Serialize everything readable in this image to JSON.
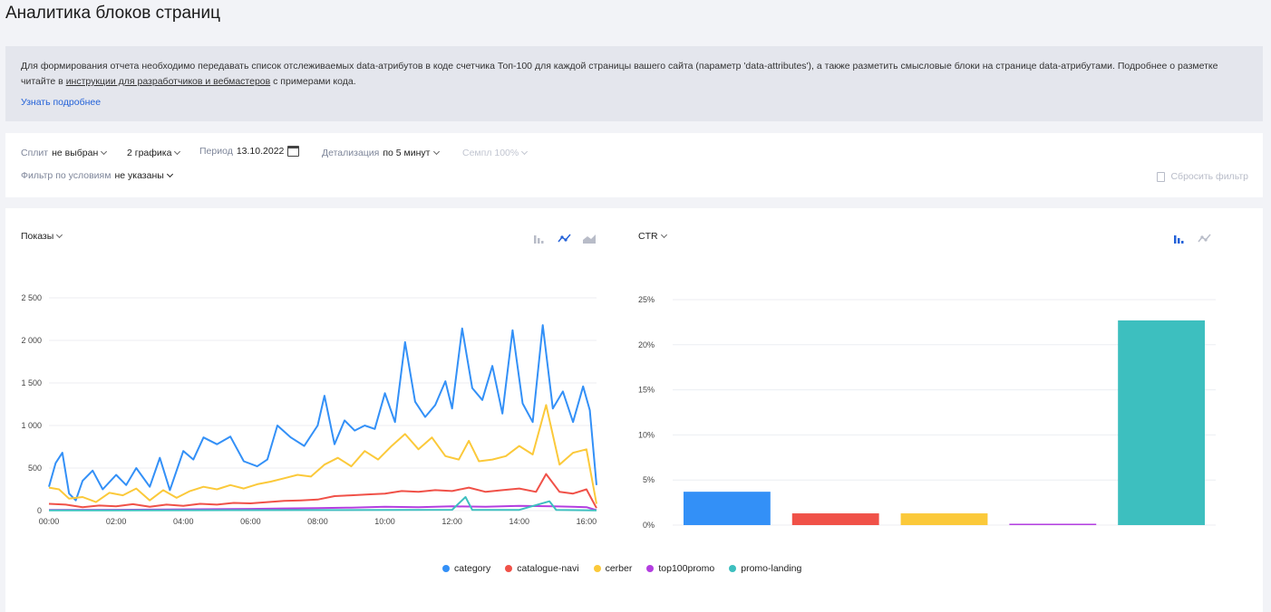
{
  "page": {
    "title": "Аналитика блоков страниц"
  },
  "notice": {
    "text_1": "Для формирования отчета необходимо передавать список отслеживаемых data-атрибутов в коде счетчика Топ-100 для каждой страницы вашего сайта (параметр 'data-attributes'), а также разметить смысловые блоки на странице data-атрибутами. Подробнее о разметке читайте в ",
    "link_inline": "инструкции для разработчиков и вебмастеров",
    "text_2": " с примерами кода.",
    "more_link": "Узнать подробнее"
  },
  "filters": {
    "split_label": "Сплит",
    "split_value": "не выбран",
    "graphs_value": "2 графика",
    "period_label": "Период",
    "period_value": "13.10.2022",
    "detail_label": "Детализация",
    "detail_value": "по 5 минут",
    "sample_label": "Семпл 100%",
    "condition_label": "Фильтр по условиям",
    "condition_value": "не указаны",
    "reset_label": "Сбросить фильтр"
  },
  "colors": {
    "category": "#3390f7",
    "catalogue-navi": "#f05148",
    "cerber": "#fbc93a",
    "top100promo": "#b33ee0",
    "promo-landing": "#3dbfbf",
    "accent": "#2462d8"
  },
  "icons": {
    "bar_type": "bar-chart-icon",
    "line_type": "line-chart-icon",
    "area_type": "area-chart-icon",
    "calendar": "calendar-icon",
    "reset": "trash-icon"
  },
  "chart_data": [
    {
      "type": "line",
      "title": "Показы",
      "x_label_ticks": [
        "00:00",
        "02:00",
        "04:00",
        "06:00",
        "08:00",
        "10:00",
        "12:00",
        "14:00",
        "16:00"
      ],
      "y_ticks": [
        "0",
        "500",
        "1 000",
        "1 500",
        "2 000",
        "2 500"
      ],
      "ylim": [
        0,
        2500
      ],
      "x_range_hours": [
        0,
        16.3
      ],
      "grid": true,
      "series": [
        {
          "name": "category",
          "color": "#3390f7",
          "points": [
            [
              0,
              280
            ],
            [
              0.2,
              560
            ],
            [
              0.4,
              680
            ],
            [
              0.6,
              200
            ],
            [
              0.8,
              120
            ],
            [
              1,
              350
            ],
            [
              1.3,
              470
            ],
            [
              1.6,
              250
            ],
            [
              2,
              420
            ],
            [
              2.3,
              300
            ],
            [
              2.6,
              500
            ],
            [
              3,
              280
            ],
            [
              3.3,
              620
            ],
            [
              3.6,
              240
            ],
            [
              4,
              700
            ],
            [
              4.3,
              600
            ],
            [
              4.6,
              860
            ],
            [
              5,
              780
            ],
            [
              5.4,
              870
            ],
            [
              5.8,
              580
            ],
            [
              6.2,
              520
            ],
            [
              6.5,
              600
            ],
            [
              6.8,
              1000
            ],
            [
              7.2,
              860
            ],
            [
              7.6,
              760
            ],
            [
              8,
              1000
            ],
            [
              8.2,
              1350
            ],
            [
              8.5,
              780
            ],
            [
              8.8,
              1060
            ],
            [
              9.1,
              940
            ],
            [
              9.4,
              1000
            ],
            [
              9.7,
              960
            ],
            [
              10,
              1380
            ],
            [
              10.3,
              1040
            ],
            [
              10.6,
              1980
            ],
            [
              10.9,
              1280
            ],
            [
              11.2,
              1100
            ],
            [
              11.5,
              1240
            ],
            [
              11.8,
              1520
            ],
            [
              12,
              1200
            ],
            [
              12.3,
              2140
            ],
            [
              12.6,
              1440
            ],
            [
              12.9,
              1300
            ],
            [
              13.2,
              1700
            ],
            [
              13.5,
              1140
            ],
            [
              13.8,
              2120
            ],
            [
              14.1,
              1260
            ],
            [
              14.4,
              1040
            ],
            [
              14.7,
              2180
            ],
            [
              15,
              1200
            ],
            [
              15.3,
              1400
            ],
            [
              15.6,
              1040
            ],
            [
              15.9,
              1460
            ],
            [
              16.1,
              1180
            ],
            [
              16.3,
              300
            ]
          ]
        },
        {
          "name": "cerber",
          "color": "#fbc93a",
          "points": [
            [
              0,
              270
            ],
            [
              0.3,
              250
            ],
            [
              0.6,
              140
            ],
            [
              1,
              160
            ],
            [
              1.4,
              100
            ],
            [
              1.8,
              210
            ],
            [
              2.2,
              180
            ],
            [
              2.6,
              260
            ],
            [
              3,
              120
            ],
            [
              3.4,
              240
            ],
            [
              3.8,
              150
            ],
            [
              4.2,
              230
            ],
            [
              4.6,
              280
            ],
            [
              5,
              250
            ],
            [
              5.4,
              300
            ],
            [
              5.8,
              260
            ],
            [
              6.2,
              310
            ],
            [
              6.6,
              340
            ],
            [
              7,
              380
            ],
            [
              7.4,
              420
            ],
            [
              7.8,
              400
            ],
            [
              8.2,
              540
            ],
            [
              8.6,
              620
            ],
            [
              9,
              520
            ],
            [
              9.4,
              700
            ],
            [
              9.8,
              600
            ],
            [
              10.2,
              760
            ],
            [
              10.6,
              900
            ],
            [
              11,
              720
            ],
            [
              11.4,
              860
            ],
            [
              11.8,
              640
            ],
            [
              12.2,
              600
            ],
            [
              12.5,
              820
            ],
            [
              12.8,
              580
            ],
            [
              13.2,
              600
            ],
            [
              13.6,
              640
            ],
            [
              14,
              760
            ],
            [
              14.4,
              660
            ],
            [
              14.8,
              1240
            ],
            [
              15.2,
              540
            ],
            [
              15.6,
              680
            ],
            [
              16,
              720
            ],
            [
              16.3,
              80
            ]
          ]
        },
        {
          "name": "catalogue-navi",
          "color": "#f05148",
          "points": [
            [
              0,
              80
            ],
            [
              0.5,
              70
            ],
            [
              1,
              40
            ],
            [
              1.5,
              60
            ],
            [
              2,
              50
            ],
            [
              2.5,
              75
            ],
            [
              3,
              45
            ],
            [
              3.5,
              70
            ],
            [
              4,
              55
            ],
            [
              4.5,
              80
            ],
            [
              5,
              70
            ],
            [
              5.5,
              90
            ],
            [
              6,
              85
            ],
            [
              6.5,
              100
            ],
            [
              7,
              115
            ],
            [
              7.5,
              120
            ],
            [
              8,
              130
            ],
            [
              8.5,
              170
            ],
            [
              9,
              180
            ],
            [
              9.5,
              190
            ],
            [
              10,
              200
            ],
            [
              10.5,
              230
            ],
            [
              11,
              220
            ],
            [
              11.5,
              240
            ],
            [
              12,
              230
            ],
            [
              12.5,
              270
            ],
            [
              13,
              220
            ],
            [
              13.5,
              240
            ],
            [
              14,
              260
            ],
            [
              14.5,
              220
            ],
            [
              14.8,
              430
            ],
            [
              15.2,
              220
            ],
            [
              15.6,
              200
            ],
            [
              16,
              250
            ],
            [
              16.3,
              30
            ]
          ]
        },
        {
          "name": "top100promo",
          "color": "#b33ee0",
          "points": [
            [
              0,
              8
            ],
            [
              2,
              10
            ],
            [
              4,
              15
            ],
            [
              6,
              20
            ],
            [
              7,
              25
            ],
            [
              8,
              30
            ],
            [
              9,
              35
            ],
            [
              10,
              45
            ],
            [
              11,
              40
            ],
            [
              12,
              50
            ],
            [
              13,
              45
            ],
            [
              14,
              55
            ],
            [
              15,
              50
            ],
            [
              16,
              40
            ],
            [
              16.3,
              5
            ]
          ]
        },
        {
          "name": "promo-landing",
          "color": "#3dbfbf",
          "points": [
            [
              0,
              2
            ],
            [
              4,
              4
            ],
            [
              8,
              6
            ],
            [
              12,
              10
            ],
            [
              12.4,
              160
            ],
            [
              12.6,
              8
            ],
            [
              14,
              8
            ],
            [
              14.9,
              110
            ],
            [
              15.1,
              8
            ],
            [
              16.3,
              3
            ]
          ]
        }
      ]
    },
    {
      "type": "bar",
      "title": "CTR",
      "categories": [
        "category",
        "catalogue-navi",
        "cerber",
        "top100promo",
        "promo-landing"
      ],
      "values": [
        3.7,
        1.3,
        1.3,
        0.15,
        22.7
      ],
      "colors": [
        "#3390f7",
        "#f05148",
        "#fbc93a",
        "#b33ee0",
        "#3dbfbf"
      ],
      "y_ticks": [
        "0%",
        "5%",
        "10%",
        "15%",
        "20%",
        "25%"
      ],
      "ylim": [
        0,
        25
      ],
      "grid": true
    }
  ],
  "legend": [
    {
      "label": "category",
      "color": "#3390f7"
    },
    {
      "label": "catalogue-navi",
      "color": "#f05148"
    },
    {
      "label": "cerber",
      "color": "#fbc93a"
    },
    {
      "label": "top100promo",
      "color": "#b33ee0"
    },
    {
      "label": "promo-landing",
      "color": "#3dbfbf"
    }
  ]
}
